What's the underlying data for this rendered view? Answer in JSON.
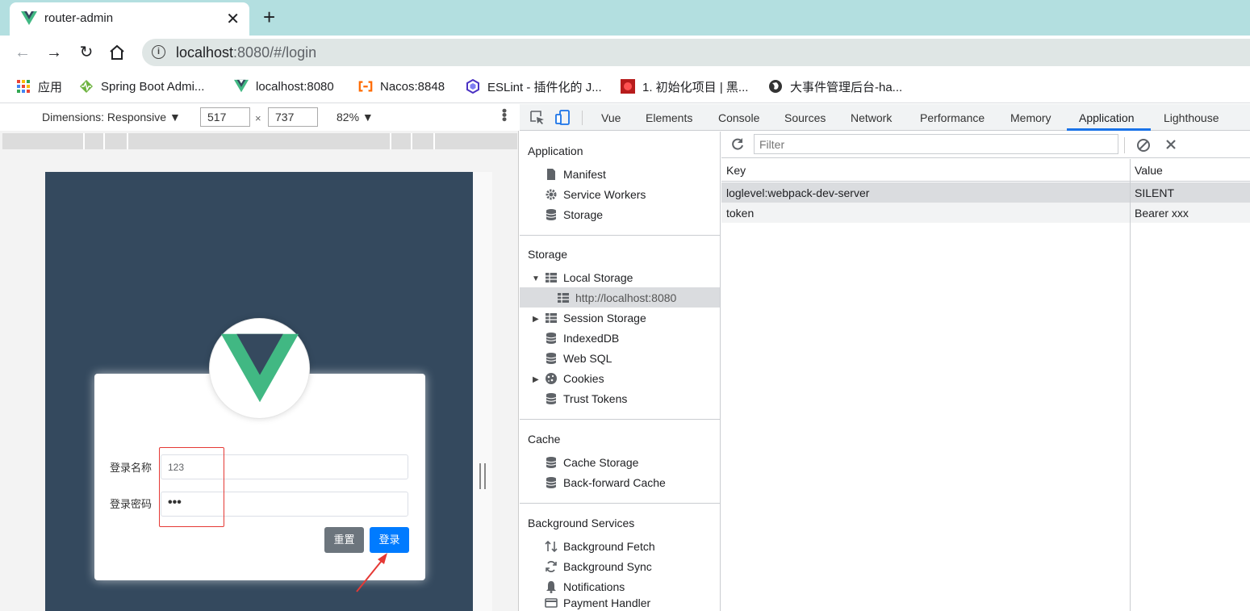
{
  "browser": {
    "tab_title": "router-admin",
    "url_host": "localhost",
    "url_rest": ":8080/#/login"
  },
  "bookmarks": [
    {
      "label": "应用",
      "icon": "apps-grid-icon"
    },
    {
      "label": "Spring Boot Admi...",
      "icon": "pulse-icon"
    },
    {
      "label": "localhost:8080",
      "icon": "vue-icon"
    },
    {
      "label": "Nacos:8848",
      "icon": "nacos-icon"
    },
    {
      "label": "ESLint - 插件化的 J...",
      "icon": "eslint-icon"
    },
    {
      "label": "1. 初始化项目 | 黑...",
      "icon": "heima-icon"
    },
    {
      "label": "大事件管理后台-ha...",
      "icon": "globe-icon"
    }
  ],
  "emulation": {
    "dimensions_label": "Dimensions: Responsive ▼",
    "width": "517",
    "height": "737",
    "times": "×",
    "zoom": "82% ▼"
  },
  "login": {
    "username_label": "登录名称",
    "username_value": "123",
    "password_label": "登录密码",
    "password_value": "•••",
    "reset_label": "重置",
    "login_label": "登录"
  },
  "devtools": {
    "tabs": [
      "Vue",
      "Elements",
      "Console",
      "Sources",
      "Network",
      "Performance",
      "Memory",
      "Application",
      "Lighthouse"
    ],
    "active_tab": "Application",
    "sidebar": {
      "application_head": "Application",
      "application_items": [
        "Manifest",
        "Service Workers",
        "Storage"
      ],
      "storage_head": "Storage",
      "storage_items": [
        "Local Storage",
        "http://localhost:8080",
        "Session Storage",
        "IndexedDB",
        "Web SQL",
        "Cookies",
        "Trust Tokens"
      ],
      "cache_head": "Cache",
      "cache_items": [
        "Cache Storage",
        "Back-forward Cache"
      ],
      "bg_head": "Background Services",
      "bg_items": [
        "Background Fetch",
        "Background Sync",
        "Notifications",
        "Payment Handler"
      ]
    },
    "filter_placeholder": "Filter",
    "table": {
      "headers": [
        "Key",
        "Value"
      ],
      "rows": [
        {
          "key": "loglevel:webpack-dev-server",
          "value": "SILENT"
        },
        {
          "key": "token",
          "value": "Bearer xxx"
        }
      ]
    }
  },
  "colors": {
    "tabstrip": "#b3dfe0",
    "viewport_bg": "#34495e",
    "vue_green": "#41b883",
    "vue_dark": "#35495e",
    "login_blue": "#007bff",
    "reset_gray": "#6c757d",
    "annotation_red": "#e53935",
    "devtools_accent": "#1a73e8"
  }
}
